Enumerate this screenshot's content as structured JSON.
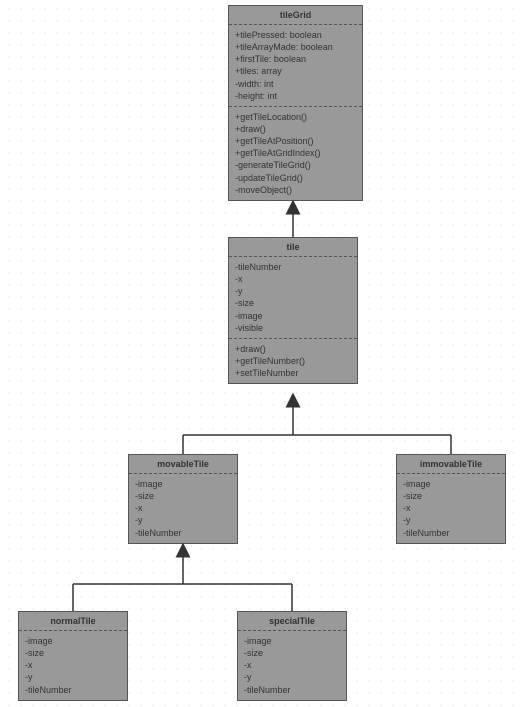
{
  "classes": {
    "tileGrid": {
      "name": "tileGrid",
      "attributes": [
        "+tilePressed: boolean",
        "+tileArrayMade: boolean",
        "+firstTile: boolean",
        "+tiles: array",
        "-width: int",
        "-height: int"
      ],
      "methods": [
        "+getTileLocation()",
        "+draw()",
        "+getTileAtPosition()",
        "+getTileAtGridIndex()",
        "-generateTileGrid()",
        "-updateTileGrid()",
        "-moveObject()"
      ]
    },
    "tile": {
      "name": "tile",
      "attributes": [
        "-tileNumber",
        "-x",
        "-y",
        "-size",
        "-image",
        "-visible"
      ],
      "methods": [
        "+draw()",
        "+getTileNumber()",
        "+setTileNumber"
      ]
    },
    "movableTile": {
      "name": "movableTile",
      "attributes": [
        "-image",
        "-size",
        "-x",
        "-y",
        "-tileNumber"
      ]
    },
    "immovableTile": {
      "name": "immovableTile",
      "attributes": [
        "-image",
        "-size",
        "-x",
        "-y",
        "-tileNumber"
      ]
    },
    "normalTile": {
      "name": "normalTile",
      "attributes": [
        "-image",
        "-size",
        "-x",
        "-y",
        "-tileNumber"
      ]
    },
    "specialTile": {
      "name": "specialTile",
      "attributes": [
        "-image",
        "-size",
        "-x",
        "-y",
        "-tileNumber"
      ]
    }
  }
}
